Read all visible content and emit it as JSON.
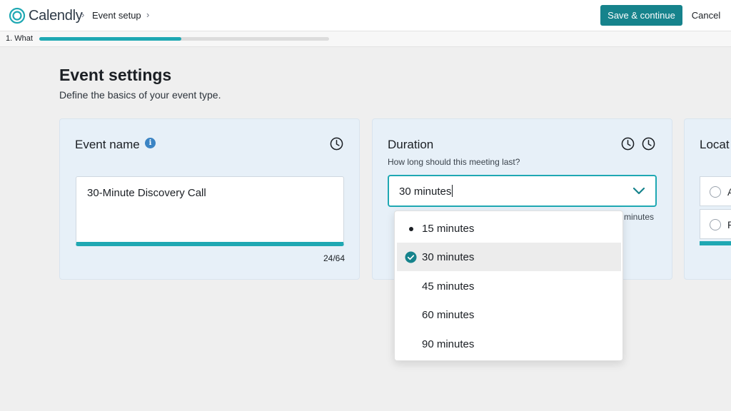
{
  "app": {
    "brand": "Calendly"
  },
  "breadcrumb": {
    "current": "Event setup"
  },
  "actions": {
    "save_label": "Save & continue",
    "cancel_label": "Cancel"
  },
  "steps": {
    "label": "1. What",
    "progress": 0.49
  },
  "page": {
    "title": "Event settings",
    "subtitle": "Define the basics of your event type."
  },
  "event_name": {
    "title": "Event name",
    "value": "30-Minute Discovery Call",
    "counter": "24/64"
  },
  "duration": {
    "title": "Duration",
    "help": "How long should this meeting last?",
    "value": "30 minutes",
    "hint_fragment": "minutes",
    "options": [
      {
        "label": "15 minutes",
        "marker": "bullet"
      },
      {
        "label": "30 minutes",
        "marker": "check",
        "selected": true
      },
      {
        "label": "45 minutes",
        "marker": "none"
      },
      {
        "label": "60 minutes",
        "marker": "none"
      },
      {
        "label": "90 minutes",
        "marker": "none"
      }
    ]
  },
  "location": {
    "title_fragment": "Locat",
    "options": [
      {
        "label_fragment": "A"
      },
      {
        "label_fragment": "P"
      }
    ]
  },
  "colors": {
    "accent": "#16838c",
    "progress": "#1fa8b3",
    "card_bg": "#e7f0f8",
    "info": "#3b84c4"
  }
}
